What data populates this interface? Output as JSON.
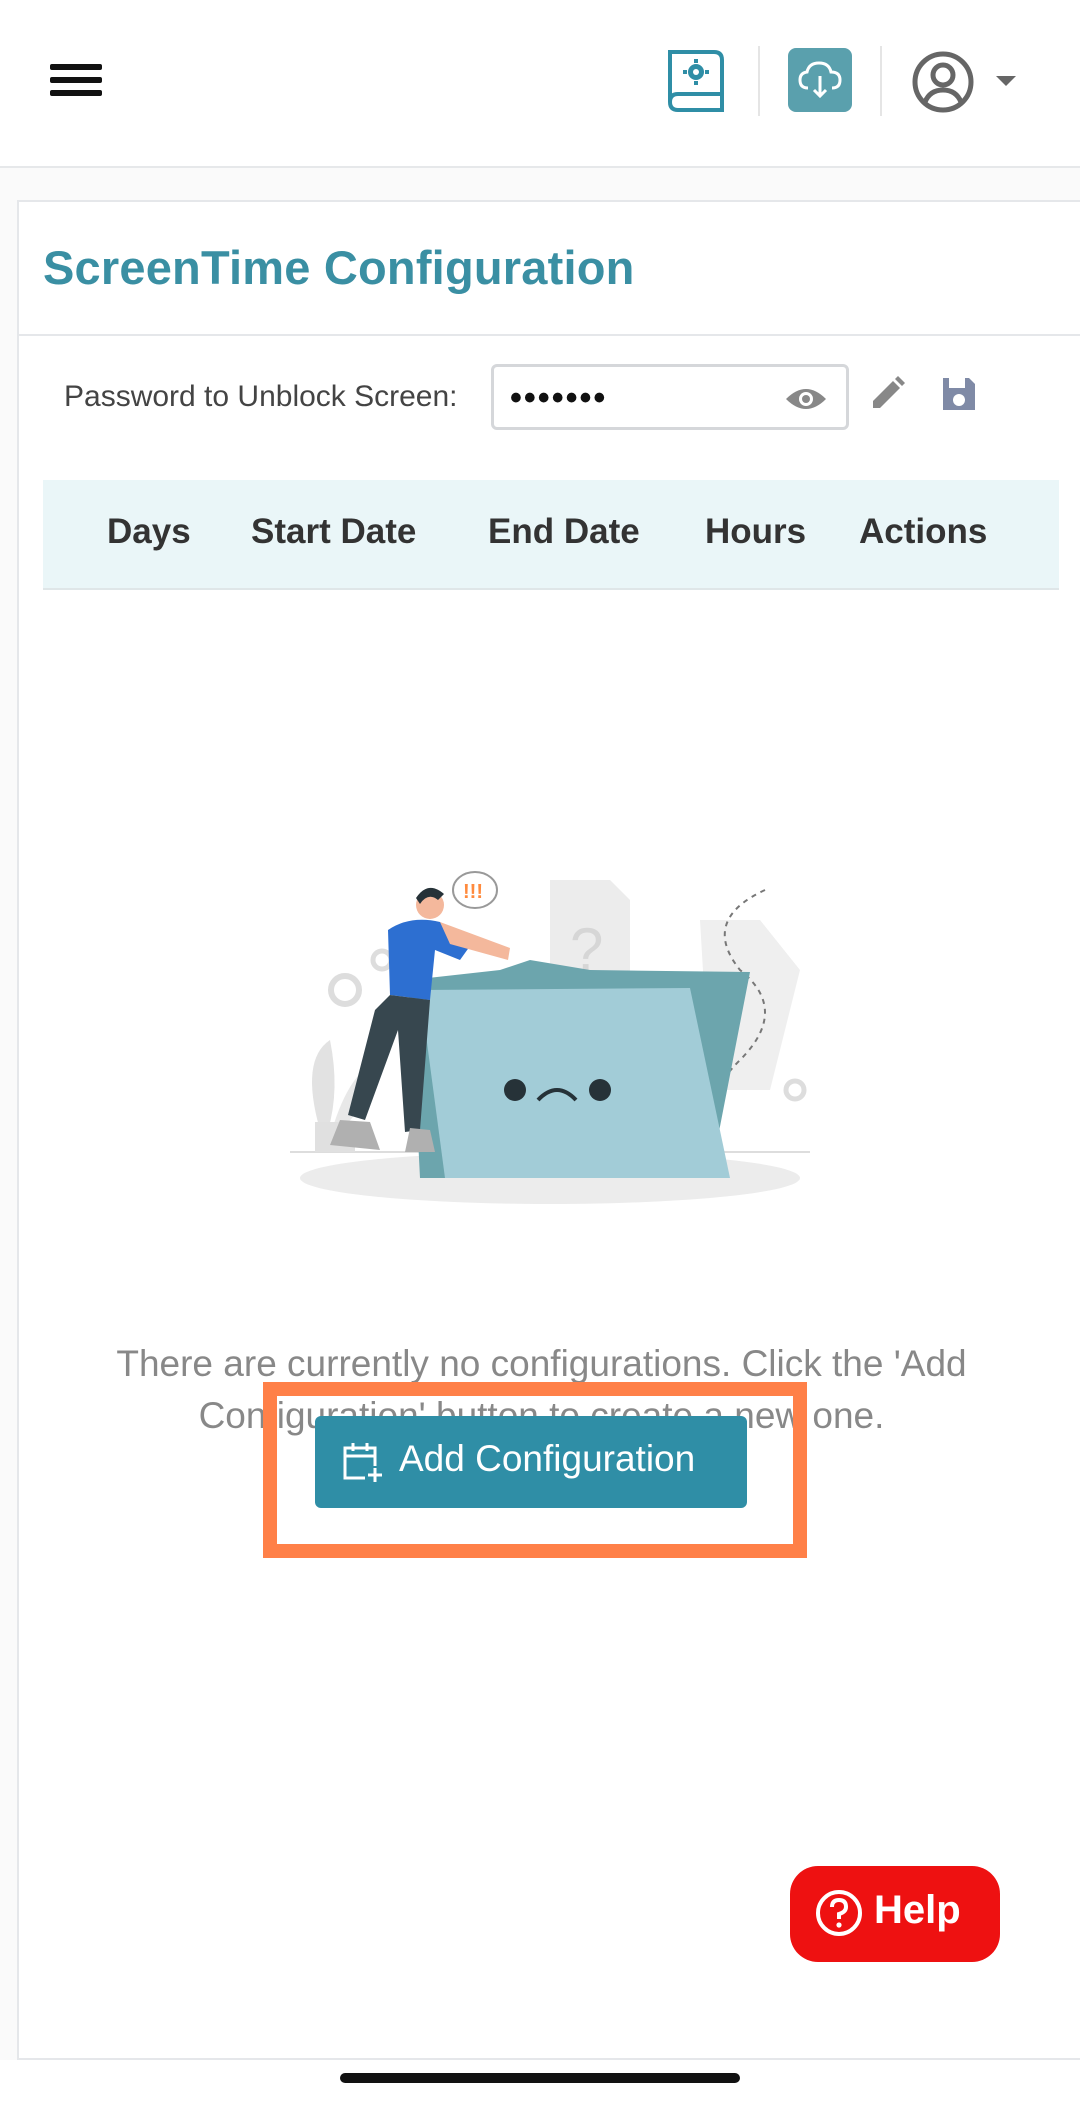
{
  "header": {
    "icons": [
      "menu-icon",
      "settings-guide-icon",
      "cloud-download-icon",
      "account-icon",
      "caret-down-icon"
    ]
  },
  "card": {
    "title": "ScreenTime Configuration",
    "password_label": "Password to Unblock Screen:",
    "password_value": "•••••••",
    "icons": [
      "eye-icon",
      "pencil-icon",
      "save-icon"
    ]
  },
  "table": {
    "headers": [
      "Days",
      "Start Date",
      "End Date",
      "Hours",
      "Actions"
    ]
  },
  "empty_state": {
    "message": "There are currently no configurations. Click the 'Add Configuration' button to create a new one.",
    "button_label": "Add Configuration",
    "button_icon": "calendar-add-icon"
  },
  "help": {
    "label": "Help",
    "icon": "question-circle-icon"
  },
  "colors": {
    "accent": "#3a8fa3",
    "button": "#2f8ea6",
    "highlight": "#ff8048",
    "help": "#ee1111",
    "table_header_bg": "#eaf6f8"
  }
}
